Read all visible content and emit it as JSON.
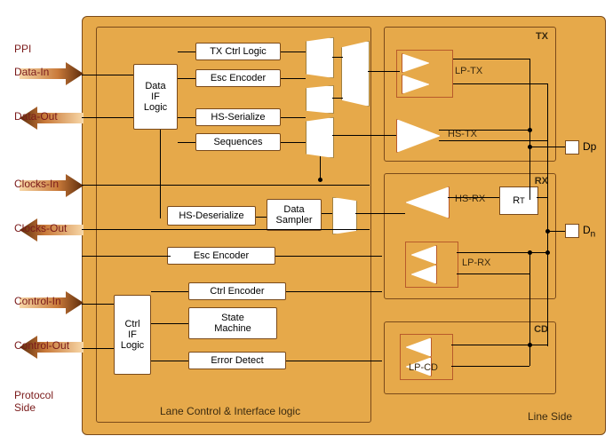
{
  "ppi": {
    "title": "PPI",
    "dataIn": "Data-In",
    "dataOut": "Data-Out",
    "clocksIn": "Clocks-In",
    "clocksOut": "Clocks-Out",
    "controlIn": "Control-In",
    "controlOut": "Control-Out",
    "protocolSide": "Protocol\nSide"
  },
  "laneControl": {
    "title": "Lane Control & Interface logic",
    "dataIF": "Data\nIF\nLogic",
    "ctrlIF": "Ctrl\nIF\nLogic",
    "txCtrl": "TX Ctrl Logic",
    "escEncoder": "Esc Encoder",
    "hsSerialize": "HS-Serialize",
    "sequences": "Sequences",
    "hsDeserialize": "HS-Deserialize",
    "dataSampler": "Data\nSampler",
    "escEncoder2": "Esc Encoder",
    "ctrlEncoder": "Ctrl Encoder",
    "stateMachine": "State\nMachine",
    "errorDetect": "Error Detect"
  },
  "tx": {
    "title": "TX",
    "lpTx": "LP-TX",
    "hsTx": "HS-TX"
  },
  "rx": {
    "title": "RX",
    "hsRx": "HS-RX",
    "rt": "R",
    "rtSub": "T",
    "lpRx": "LP-RX"
  },
  "cd": {
    "title": "CD",
    "lpCd": "LP-CD"
  },
  "pins": {
    "dp": "Dp",
    "dn": "Dn"
  },
  "lineSide": "Line Side"
}
